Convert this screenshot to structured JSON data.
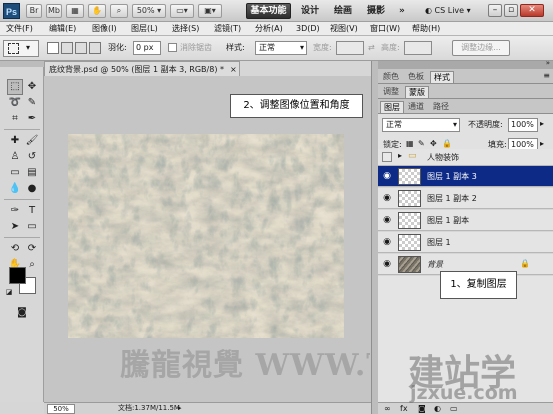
{
  "app": {
    "logo": "Ps",
    "zoom": "50%",
    "workspaces": [
      "基本功能",
      "设计",
      "绘画",
      "摄影"
    ],
    "cs_live": "CS Live"
  },
  "menu": [
    "文件(F)",
    "编辑(E)",
    "图像(I)",
    "图层(L)",
    "选择(S)",
    "滤镜(T)",
    "分析(A)",
    "3D(D)",
    "视图(V)",
    "窗口(W)",
    "帮助(H)"
  ],
  "options": {
    "feather_label": "羽化:",
    "feather_value": "0 px",
    "antialias_label": "消除锯齿",
    "style_label": "样式:",
    "style_value": "正常",
    "width_label": "宽度:",
    "height_label": "高度:",
    "refine_edge": "调整边缘..."
  },
  "document": {
    "tab_title": "底纹背景.psd @ 50% (图层 1 副本 3, RGB/8) *",
    "zoom_status": "50%",
    "doc_size": "文档:1.37M/11.5M",
    "watermark": "騰龍視覺 WWW.TL"
  },
  "annotations": {
    "step2": "2、调整图像位置和角度",
    "step1": "1、复制图层"
  },
  "panels": {
    "top_tabs": [
      "颜色",
      "色板",
      "样式"
    ],
    "mid_tabs": [
      "调整",
      "蒙版"
    ],
    "layer_tabs": [
      "图层",
      "通道",
      "路径"
    ],
    "blend_mode": "正常",
    "opacity_label": "不透明度:",
    "opacity_value": "100%",
    "lock_label": "锁定:",
    "fill_label": "填充:",
    "fill_value": "100%"
  },
  "layers": [
    {
      "name": "人物装饰",
      "type": "group"
    },
    {
      "name": "图层 1 副本 3",
      "type": "layer",
      "selected": true
    },
    {
      "name": "图层 1 副本 2",
      "type": "layer"
    },
    {
      "name": "图层 1 副本",
      "type": "layer"
    },
    {
      "name": "图层 1",
      "type": "layer"
    },
    {
      "name": "背景",
      "type": "background"
    }
  ],
  "site_watermark": {
    "line1": "建站学",
    "line2": "jzxue.com"
  },
  "colors": {
    "selected_layer": "#0c2a86",
    "foreground": "#000000",
    "background": "#ffffff"
  }
}
